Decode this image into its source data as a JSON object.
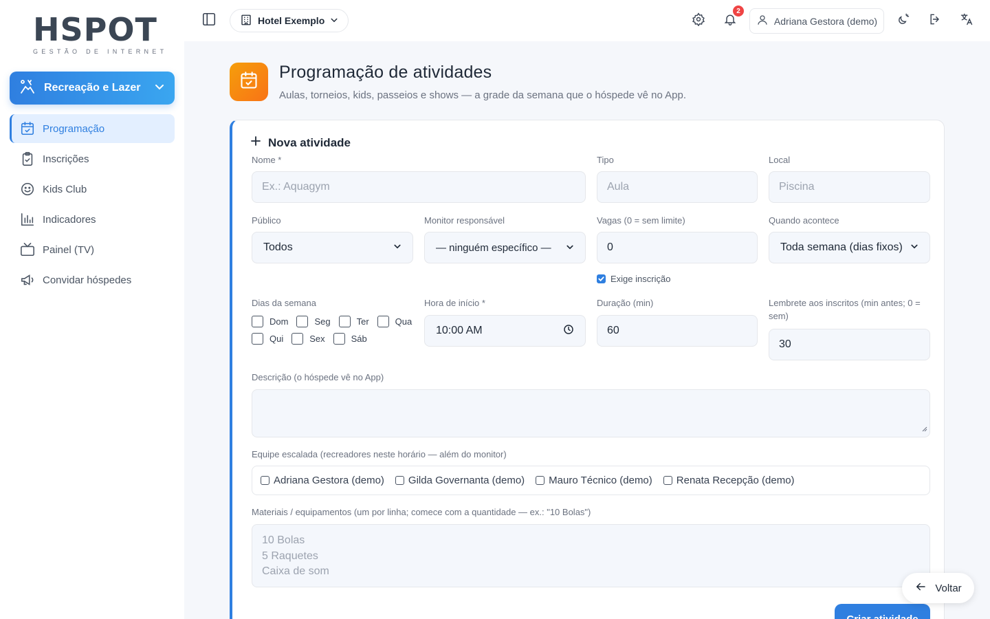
{
  "brand": {
    "logo_main": "HSPOT",
    "logo_sub": "GESTÃO DE INTERNET"
  },
  "sidebar": {
    "module_label": "Recreação e Lazer",
    "items": [
      {
        "label": "Programação",
        "icon": "calendar-check-icon",
        "active": true
      },
      {
        "label": "Inscrições",
        "icon": "clipboard-check-icon",
        "active": false
      },
      {
        "label": "Kids Club",
        "icon": "smile-icon",
        "active": false
      },
      {
        "label": "Indicadores",
        "icon": "bar-chart-icon",
        "active": false
      },
      {
        "label": "Painel (TV)",
        "icon": "tv-icon",
        "active": false
      },
      {
        "label": "Convidar hóspedes",
        "icon": "megaphone-icon",
        "active": false
      }
    ]
  },
  "topbar": {
    "hotel": "Hotel Exemplo",
    "notifications_count": "2",
    "user": "Adriana Gestora (demo)"
  },
  "page": {
    "title": "Programação de atividades",
    "subtitle": "Aulas, torneios, kids, passeios e shows — a grade da semana que o hóspede vê no App."
  },
  "form": {
    "title": "Nova atividade",
    "name_label": "Nome *",
    "name_placeholder": "Ex.: Aquagym",
    "type_label": "Tipo",
    "type_placeholder": "Aula",
    "place_label": "Local",
    "place_placeholder": "Piscina",
    "audience_label": "Público",
    "audience_value": "Todos",
    "monitor_label": "Monitor responsável",
    "monitor_value": "— ninguém específico —",
    "slots_label": "Vagas (0 = sem limite)",
    "slots_value": "0",
    "when_label": "Quando acontece",
    "when_value": "Toda semana (dias fixos)",
    "requires_signup_label": "Exige inscrição",
    "days_label": "Dias da semana",
    "days": [
      "Dom",
      "Seg",
      "Ter",
      "Qua",
      "Qui",
      "Sex",
      "Sáb"
    ],
    "start_label": "Hora de início *",
    "start_value": "10:00 AM",
    "duration_label": "Duração (min)",
    "duration_value": "60",
    "reminder_label_1": "Lembrete aos inscritos (min antes; 0 =",
    "reminder_label_2": "sem)",
    "reminder_value": "30",
    "desc_label": "Descrição (o hóspede vê no App)",
    "team_label": "Equipe escalada (recreadores neste horário — além do monitor)",
    "team": [
      "Adriana Gestora (demo)",
      "Gilda Governanta (demo)",
      "Mauro Técnico (demo)",
      "Renata Recepção (demo)"
    ],
    "materials_label": "Materiais / equipamentos (um por linha; comece com a quantidade — ex.: \"10 Bolas\")",
    "materials_placeholder": [
      "10 Bolas",
      "5 Raquetes",
      "Caixa de som"
    ],
    "submit_label": "Criar atividade"
  },
  "back_label": "Voltar",
  "colors": {
    "accent": "#2f7fe0",
    "page_icon": "#f59e0b",
    "badge": "#ef4444"
  }
}
